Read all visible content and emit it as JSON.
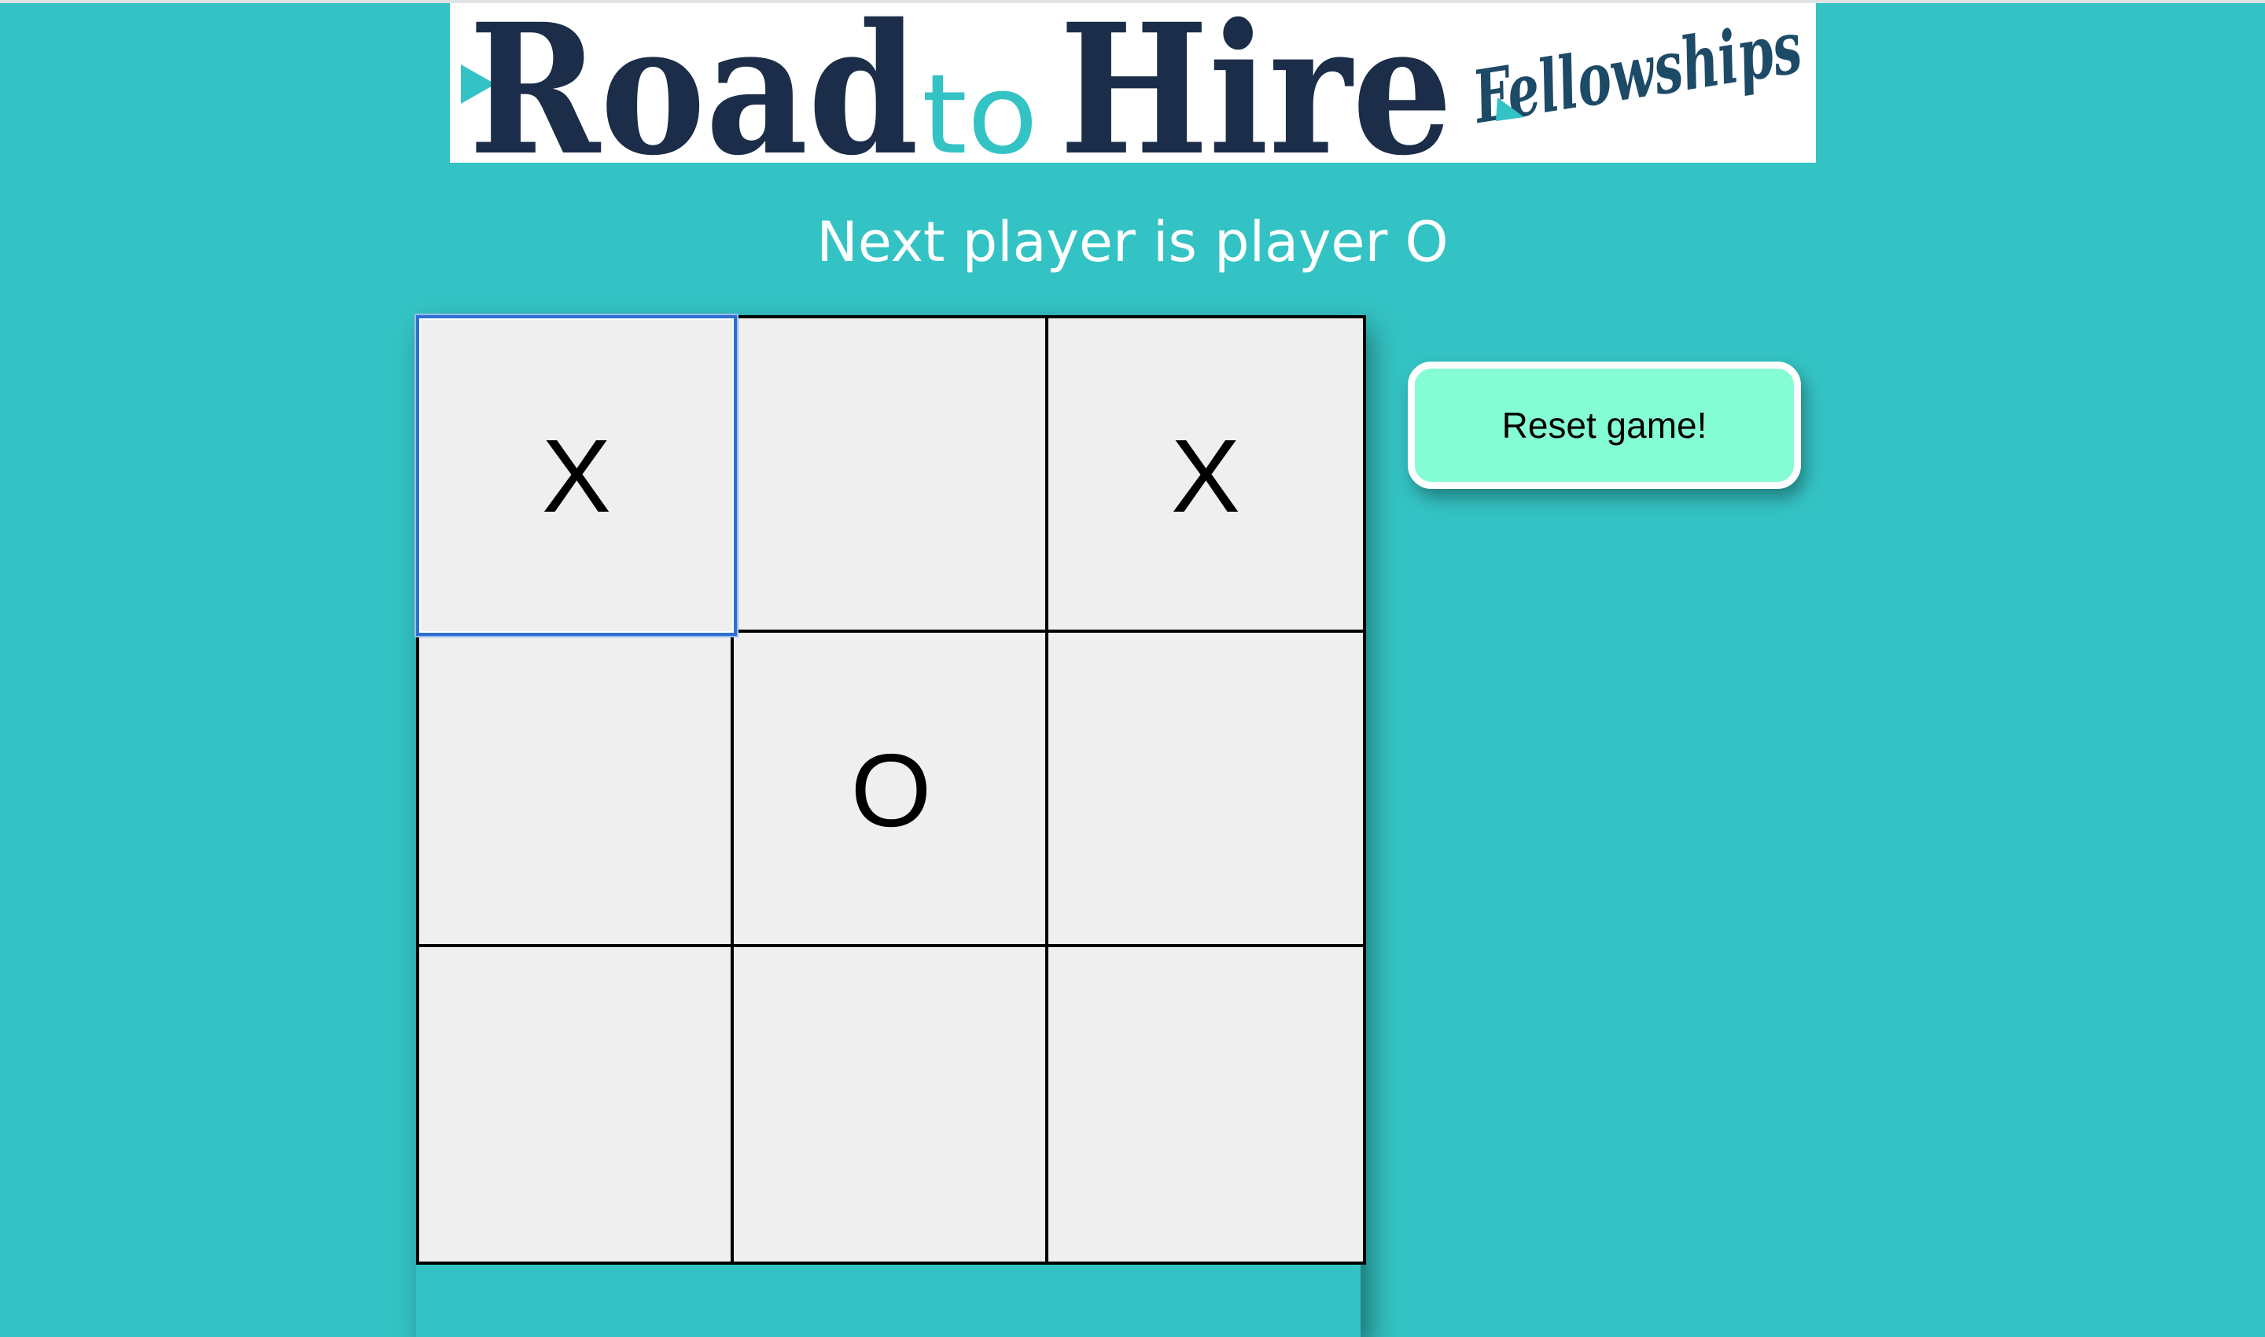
{
  "logo": {
    "road": "Road",
    "to": "to",
    "hire": "Hire",
    "fellowships": "Fellowships",
    "colors": {
      "navy": "#1b2d49",
      "teal": "#34c3c4",
      "deep_teal": "#1d4a66"
    }
  },
  "status": {
    "text": "Next player is player O"
  },
  "board": {
    "cells": [
      "X",
      "",
      "X",
      "",
      "O",
      "",
      "",
      "",
      ""
    ],
    "focused_cell": 0
  },
  "reset_button": {
    "label": "Reset game!"
  },
  "colors": {
    "background": "#34c3c4",
    "cell": "#efefef",
    "button": "#85fdd4"
  }
}
